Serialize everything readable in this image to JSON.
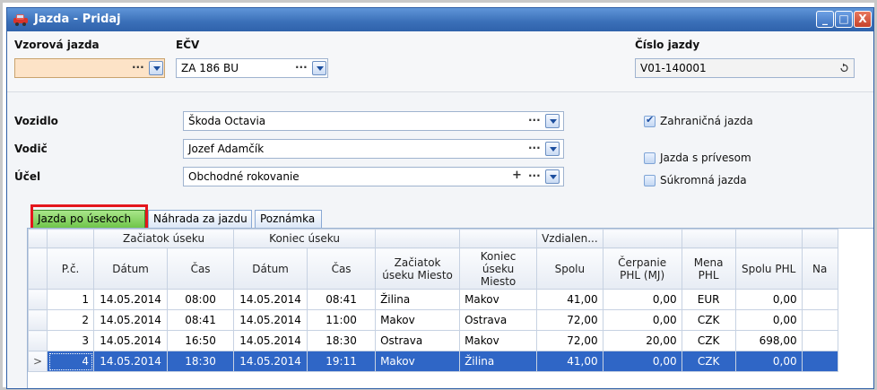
{
  "window": {
    "title": "Jazda - Pridaj",
    "buttons": [
      "_",
      "□",
      "X"
    ]
  },
  "top": {
    "vzorova_label": "Vzorová jazda",
    "ecv_label": "EČV",
    "ecv_value": "ZA 186 BU",
    "cislo_label": "Číslo jazdy",
    "cislo_value": "V01-140001",
    "dots": "···"
  },
  "mid": {
    "vozidlo_label": "Vozidlo",
    "vozidlo_value": "Škoda Octavia",
    "vodic_label": "Vodič",
    "vodic_value": "Jozef Adamčík",
    "ucel_label": "Účel",
    "ucel_value": "Obchodné rokovanie",
    "plus": "+",
    "checks": [
      {
        "label": "Zahraničná jazda",
        "checked": true
      },
      {
        "label": "Jazda s prívesom",
        "checked": false
      },
      {
        "label": "Súkromná jazda",
        "checked": false
      }
    ]
  },
  "tabs": [
    {
      "label": "Jazda po úsekoch",
      "active": true
    },
    {
      "label": "Náhrada za jazdu",
      "active": false
    },
    {
      "label": "Poznámka",
      "active": false
    }
  ],
  "grid": {
    "group_headers": {
      "start": "Začiatok úseku",
      "end": "Koniec úseku",
      "distance": "Vzdialen..."
    },
    "columns": [
      "P.č.",
      "Dátum",
      "Čas",
      "Dátum",
      "Čas",
      "Začiatok úseku Miesto",
      "Koniec úseku Miesto",
      "Spolu",
      "Čerpanie PHL (MJ)",
      "Mena PHL",
      "Spolu PHL",
      "Na"
    ],
    "rows": [
      {
        "pc": "1",
        "d1": "14.05.2014",
        "t1": "08:00",
        "d2": "14.05.2014",
        "t2": "08:41",
        "from": "Žilina",
        "to": "Makov",
        "spolu": "41,00",
        "cerpanie": "0,00",
        "mena": "EUR",
        "spolu_phl": "0,00",
        "selected": false
      },
      {
        "pc": "2",
        "d1": "14.05.2014",
        "t1": "08:41",
        "d2": "14.05.2014",
        "t2": "11:00",
        "from": "Makov",
        "to": "Ostrava",
        "spolu": "72,00",
        "cerpanie": "0,00",
        "mena": "CZK",
        "spolu_phl": "0,00",
        "selected": false
      },
      {
        "pc": "3",
        "d1": "14.05.2014",
        "t1": "16:50",
        "d2": "14.05.2014",
        "t2": "18:30",
        "from": "Ostrava",
        "to": "Makov",
        "spolu": "72,00",
        "cerpanie": "20,00",
        "mena": "CZK",
        "spolu_phl": "698,00",
        "selected": false
      },
      {
        "pc": "4",
        "d1": "14.05.2014",
        "t1": "18:30",
        "d2": "14.05.2014",
        "t2": "19:11",
        "from": "Makov",
        "to": "Žilina",
        "spolu": "41,00",
        "cerpanie": "0,00",
        "mena": "CZK",
        "spolu_phl": "0,00",
        "selected": true
      }
    ],
    "row_pointer": ">"
  }
}
